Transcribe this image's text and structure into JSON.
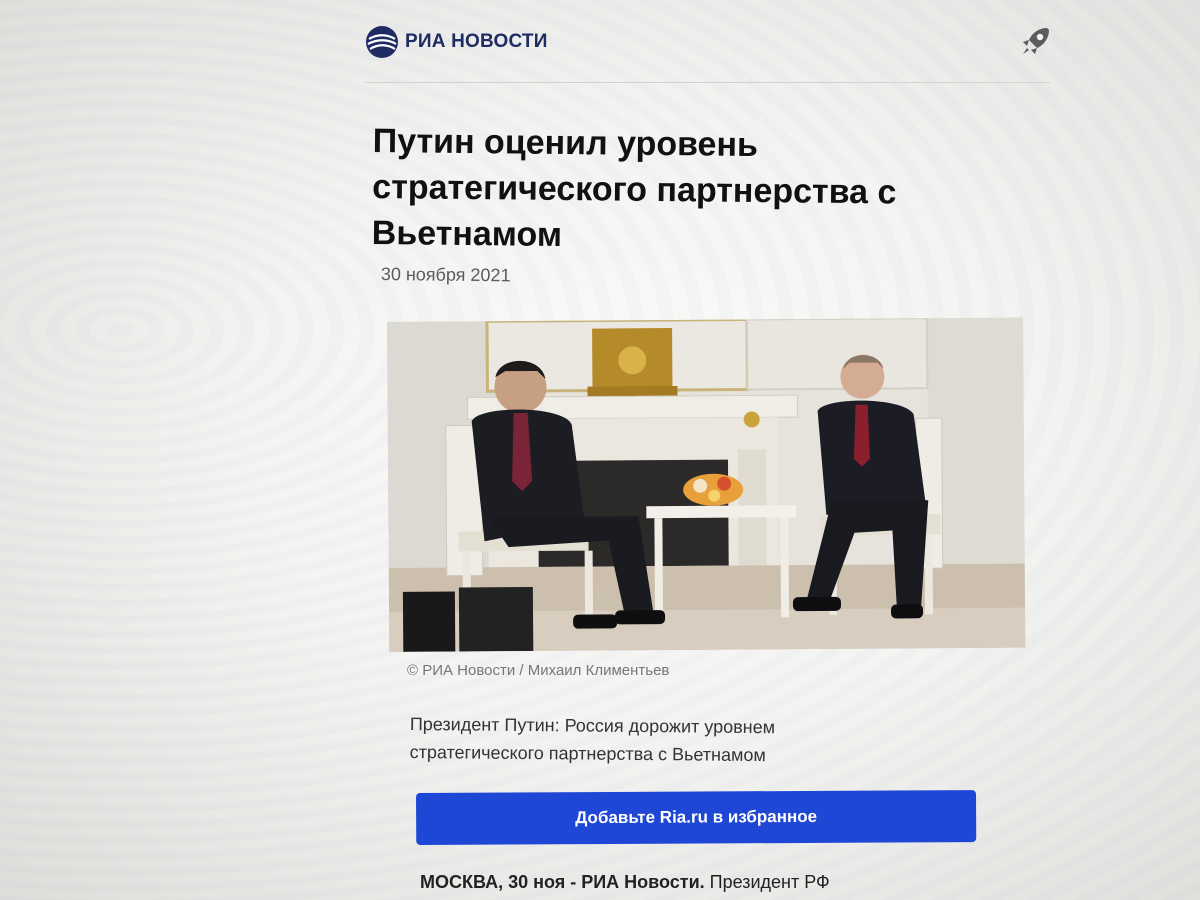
{
  "header": {
    "logo_text": "РИА НОВОСТИ",
    "logo_icon": "globe-icon",
    "action_icon": "rocket-icon"
  },
  "article": {
    "title_lines": [
      "Путин оценил уровень",
      "стратегического партнерства с",
      "Вьетнамом"
    ],
    "date": "30 ноября 2021",
    "photo_caption": "© РИА Новости / Михаил Климентьев",
    "lead_lines": [
      "Президент Путин: Россия дорожит уровнем",
      "стратегического партнерства с Вьетнамом"
    ],
    "favorite_button": "Добавьте Ria.ru в избранное",
    "body_bold": "МОСКВА, 30 ноя - РИА Новости.",
    "body_text": " Президент РФ"
  },
  "colors": {
    "brand": "#1f2c63",
    "button": "#1f47d6"
  }
}
